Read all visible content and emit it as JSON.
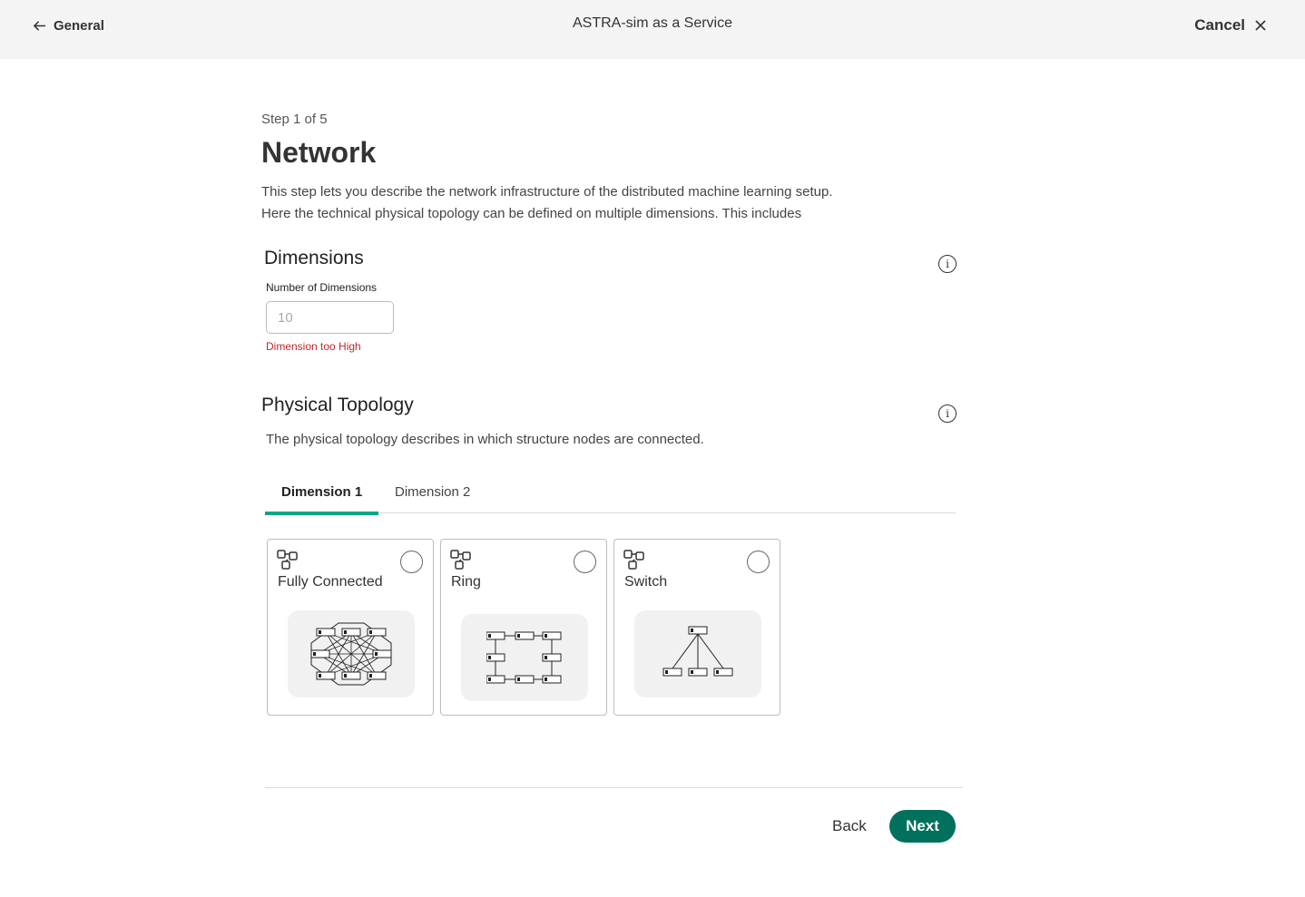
{
  "header": {
    "back_label": "General",
    "title": "ASTRA-sim as a Service",
    "cancel_label": "Cancel"
  },
  "page": {
    "step": "Step 1 of 5",
    "title": "Network",
    "description_line1": "This step lets you describe the network infrastructure of the distributed machine learning setup.",
    "description_line2": "Here the technical physical topology can be defined on multiple dimensions. This includes"
  },
  "dimensions": {
    "title": "Dimensions",
    "field_label": "Number of Dimensions",
    "placeholder": "10",
    "value": "",
    "error": "Dimension too High"
  },
  "topology": {
    "title": "Physical Topology",
    "description": "The physical topology describes in which structure nodes are connected.",
    "tabs": [
      {
        "label": "Dimension 1",
        "active": true
      },
      {
        "label": "Dimension 2",
        "active": false
      }
    ],
    "options": [
      {
        "label": "Fully Connected",
        "selected": false
      },
      {
        "label": "Ring",
        "selected": false
      },
      {
        "label": "Switch",
        "selected": false
      }
    ]
  },
  "footer": {
    "back_label": "Back",
    "next_label": "Next"
  },
  "colors": {
    "accent": "#01a982",
    "primary_button": "#01705c",
    "error": "#c3262c"
  },
  "icons": [
    "arrow-left-icon",
    "close-icon",
    "info-icon",
    "topology-icon"
  ]
}
